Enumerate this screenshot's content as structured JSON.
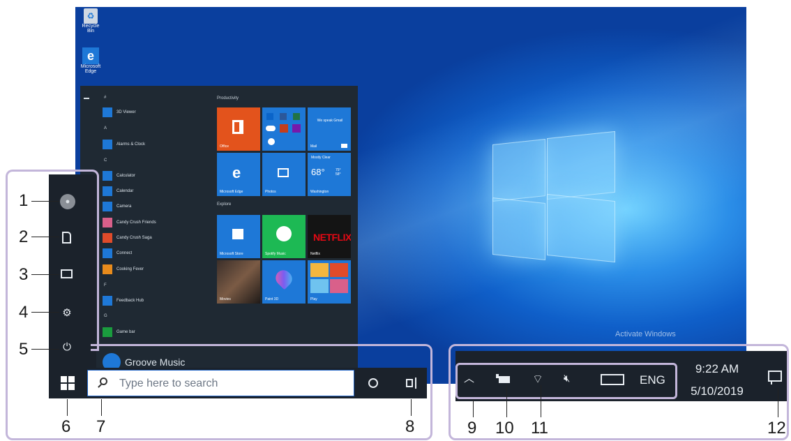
{
  "desktop": {
    "watermark": "Activate Windows",
    "icons": [
      {
        "name": "recycle-bin-icon",
        "label": "Recycle Bin"
      },
      {
        "name": "edge-icon",
        "label": "Microsoft Edge"
      }
    ]
  },
  "start_menu": {
    "apps": [
      {
        "letter": "#",
        "items": [
          "3D Viewer"
        ]
      },
      {
        "letter": "A",
        "items": [
          "Alarms & Clock"
        ]
      },
      {
        "letter": "C",
        "items": [
          "Calculator",
          "Calendar",
          "Camera",
          "Candy Crush Friends",
          "Candy Crush Saga",
          "Connect",
          "Cooking Fever"
        ]
      },
      {
        "letter": "F",
        "items": [
          "Feedback Hub"
        ]
      },
      {
        "letter": "G",
        "items": [
          "Game bar",
          "Groove Music"
        ]
      }
    ],
    "groups": [
      "Productivity",
      "Explore"
    ],
    "tiles": [
      {
        "label": "Office",
        "color": "#e3531c"
      },
      {
        "label": "",
        "color": "#1e78d7"
      },
      {
        "label": "Mail",
        "text": "We speak Gmail",
        "color": "#1e78d7"
      },
      {
        "label": "Microsoft Edge",
        "color": "#1e78d7"
      },
      {
        "label": "Photos",
        "color": "#1e78d7"
      },
      {
        "label": "Washington",
        "text": "Mostly Clear",
        "temp": "68°",
        "hilo": "75° 58°",
        "color": "#1e78d7"
      },
      {
        "label": "Microsoft Store",
        "color": "#1e78d7"
      },
      {
        "label": "Spotify Music",
        "color": "#1db954"
      },
      {
        "label": "Netflix",
        "logo": "NETFLIX",
        "color": "#141414"
      },
      {
        "label": "Movies",
        "color": "#2a2a2a"
      },
      {
        "label": "Paint 3D",
        "color": "#1e78d7"
      },
      {
        "label": "Play",
        "color": "#1e78d7"
      }
    ]
  },
  "taskbar": {
    "search_placeholder": "Type here to search",
    "time": "9:22 AM",
    "date": "5/10/2019",
    "language": "ENG"
  },
  "callouts": [
    "1",
    "2",
    "3",
    "4",
    "5",
    "6",
    "7",
    "8",
    "9",
    "10",
    "11",
    "12"
  ],
  "colors": {
    "accent": "#1e78d7",
    "frame": "#c3b6da",
    "taskbar": "#1b222b"
  }
}
